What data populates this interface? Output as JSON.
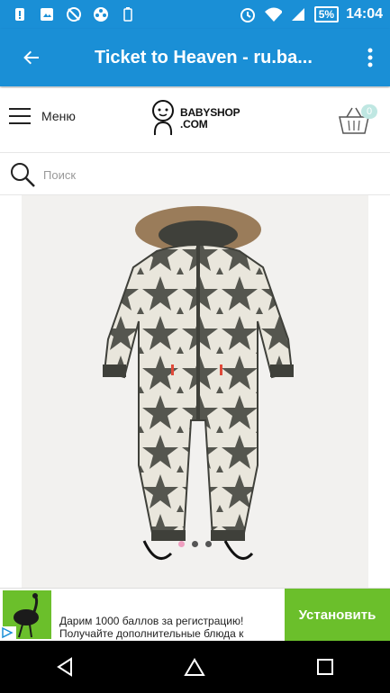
{
  "status_bar": {
    "time": "14:04",
    "battery": "5%",
    "icons": [
      "notification-alert-icon",
      "image-icon",
      "no-camera-icon",
      "film-reel-icon",
      "battery-saver-icon",
      "alarm-icon",
      "wifi-icon",
      "signal-icon"
    ]
  },
  "app_bar": {
    "title": "Ticket to Heaven - ru.ba...",
    "back_icon": "arrow-left-icon",
    "menu_icon": "more-vertical-icon"
  },
  "site_header": {
    "menu_label": "Меню",
    "logo_line1": "BABYSHOP",
    "logo_line2": ".COM",
    "cart_count": "0"
  },
  "search": {
    "placeholder": "Поиск"
  },
  "product_gallery": {
    "image_alt": "snowsuit-with-star-pattern-and-fur-hood",
    "slides": 3,
    "active_slide": 1
  },
  "ad": {
    "line1": "Дарим 1000 баллов за регистрацию!",
    "line2": "Получайте дополнительные блюда к",
    "cta": "Установить"
  },
  "colors": {
    "primary": "#1a8fd6",
    "ad_green": "#6bbf2b",
    "cart_badge": "#bfe7e2",
    "active_dot": "#ef9fc0"
  }
}
